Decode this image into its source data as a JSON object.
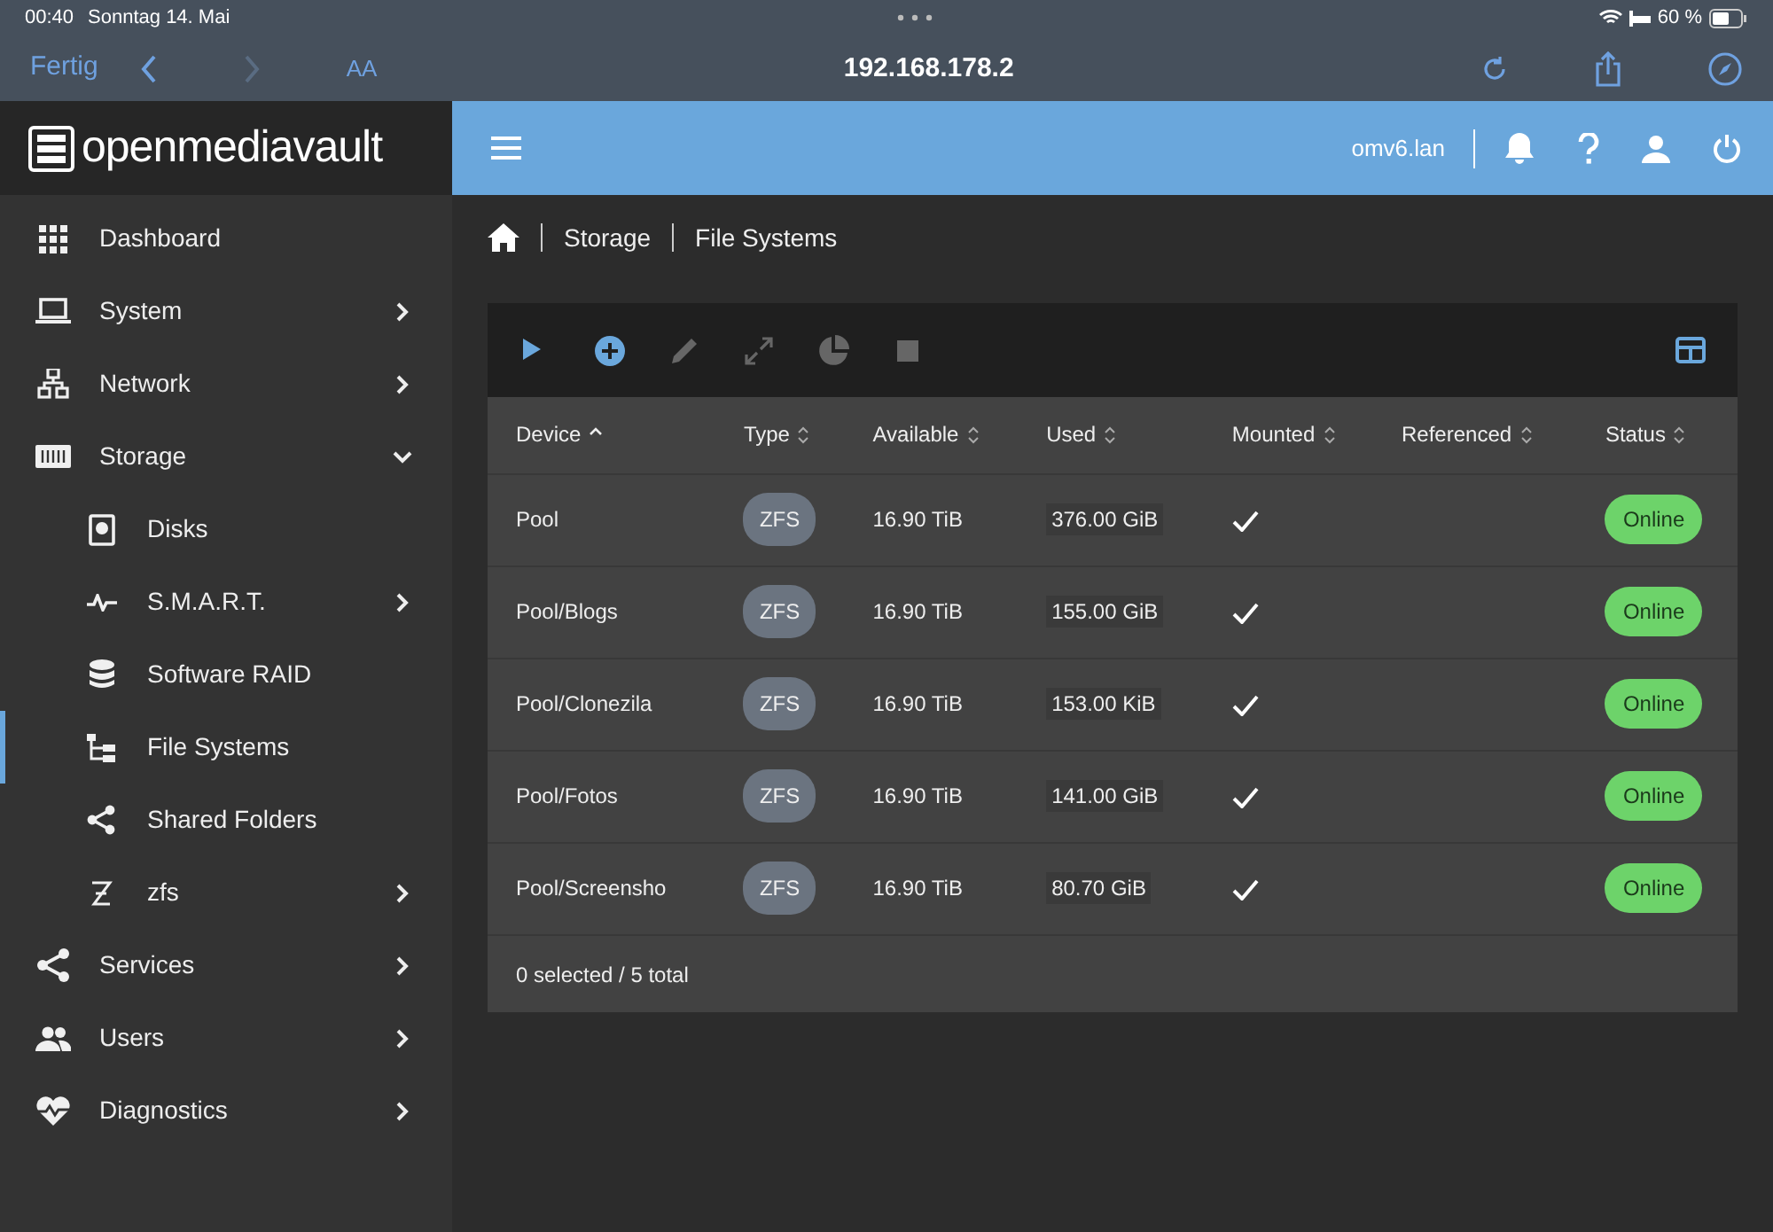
{
  "status_bar": {
    "time": "00:40",
    "date": "Sonntag 14. Mai",
    "battery": "60 %"
  },
  "browser": {
    "done": "Fertig",
    "text_size": "AA",
    "url": "192.168.178.2"
  },
  "app": {
    "logo": "openmediavault",
    "hostname": "omv6.lan"
  },
  "sidebar": {
    "items": [
      {
        "label": "Dashboard",
        "selected": false
      },
      {
        "label": "System",
        "expanded": false,
        "selected": false
      },
      {
        "label": "Network",
        "expanded": false,
        "selected": false
      },
      {
        "label": "Storage",
        "expanded": true,
        "selected": false,
        "children": [
          {
            "label": "Disks",
            "selected": false
          },
          {
            "label": "S.M.A.R.T.",
            "expanded": false,
            "selected": false
          },
          {
            "label": "Software RAID",
            "selected": false
          },
          {
            "label": "File Systems",
            "selected": true
          },
          {
            "label": "Shared Folders",
            "selected": false
          },
          {
            "label": "zfs",
            "expanded": false,
            "selected": false
          }
        ]
      },
      {
        "label": "Services",
        "expanded": false,
        "selected": false
      },
      {
        "label": "Users",
        "expanded": false,
        "selected": false
      },
      {
        "label": "Diagnostics",
        "expanded": false,
        "selected": false
      }
    ]
  },
  "breadcrumb": [
    "Storage",
    "File Systems"
  ],
  "toolbar": {
    "buttons": [
      {
        "disabled": false
      },
      {
        "disabled": false
      },
      {
        "disabled": true
      },
      {
        "disabled": true
      },
      {
        "disabled": true
      },
      {
        "disabled": true
      }
    ]
  },
  "table": {
    "columns": [
      {
        "label": "Device",
        "sorted": true
      },
      {
        "label": "Type",
        "sorted": false
      },
      {
        "label": "Available",
        "sorted": false
      },
      {
        "label": "Used",
        "sorted": false
      },
      {
        "label": "Mounted",
        "sorted": false
      },
      {
        "label": "Referenced",
        "sorted": false
      },
      {
        "label": "Status",
        "sorted": false
      }
    ],
    "rows": [
      {
        "device": "Pool",
        "type": "ZFS",
        "available": "16.90 TiB",
        "used": "376.00 GiB",
        "mounted": true,
        "status": "Online"
      },
      {
        "device": "Pool/Blogs",
        "type": "ZFS",
        "available": "16.90 TiB",
        "used": "155.00 GiB",
        "mounted": true,
        "status": "Online"
      },
      {
        "device": "Pool/Clonezila",
        "type": "ZFS",
        "available": "16.90 TiB",
        "used": "153.00 KiB",
        "mounted": true,
        "status": "Online"
      },
      {
        "device": "Pool/Fotos",
        "type": "ZFS",
        "available": "16.90 TiB",
        "used": "141.00 GiB",
        "mounted": true,
        "status": "Online"
      },
      {
        "device": "Pool/Screensho",
        "type": "ZFS",
        "available": "16.90 TiB",
        "used": "80.70 GiB",
        "mounted": true,
        "status": "Online"
      }
    ],
    "footer": "0 selected / 5 total"
  }
}
